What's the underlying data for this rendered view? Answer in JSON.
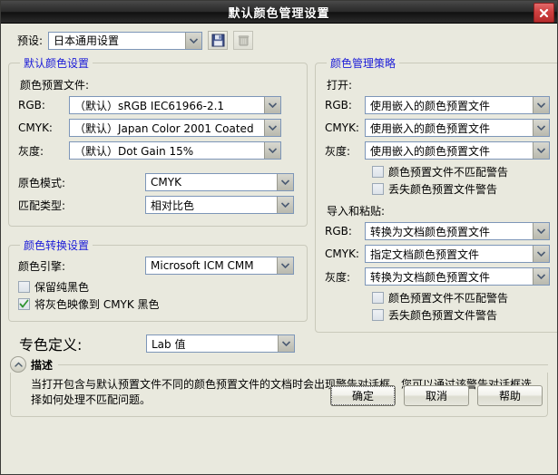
{
  "window": {
    "title": "默认颜色管理设置",
    "close_icon": "close-icon"
  },
  "preset": {
    "label": "预设:",
    "value": "日本通用设置",
    "save_icon": "save-disk-icon",
    "delete_icon": "trash-icon"
  },
  "default_color_settings": {
    "legend": "默认颜色设置",
    "profiles_label": "颜色预置文件:",
    "rows": [
      {
        "label": "RGB:",
        "value": "（默认）sRGB IEC61966-2.1"
      },
      {
        "label": "CMYK:",
        "value": "（默认）Japan Color 2001 Coated"
      },
      {
        "label": "灰度:",
        "value": "（默认）Dot Gain 15%"
      }
    ],
    "primary_mode": {
      "label": "原色模式:",
      "value": "CMYK"
    },
    "rendering_intent": {
      "label": "匹配类型:",
      "value": "相对比色"
    }
  },
  "color_conversion_settings": {
    "legend": "颜色转换设置",
    "engine": {
      "label": "颜色引擎:",
      "value": "Microsoft ICM CMM"
    },
    "checkboxes": [
      {
        "label": "保留纯黑色",
        "checked": false
      },
      {
        "label": "将灰色映像到 CMYK 黑色",
        "checked": true
      }
    ]
  },
  "spot_color": {
    "label": "专色定义:",
    "value": "Lab 值"
  },
  "color_management_policies": {
    "legend": "颜色管理策略",
    "open_label": "打开:",
    "open_rows": [
      {
        "label": "RGB:",
        "value": "使用嵌入的颜色预置文件"
      },
      {
        "label": "CMYK:",
        "value": "使用嵌入的颜色预置文件"
      },
      {
        "label": "灰度:",
        "value": "使用嵌入的颜色预置文件"
      }
    ],
    "open_checkboxes": [
      {
        "label": "颜色预置文件不匹配警告",
        "checked": false
      },
      {
        "label": "丢失颜色预置文件警告",
        "checked": false
      }
    ],
    "import_label": "导入和粘贴:",
    "import_rows": [
      {
        "label": "RGB:",
        "value": "转换为文档颜色预置文件"
      },
      {
        "label": "CMYK:",
        "value": "指定文档颜色预置文件"
      },
      {
        "label": "灰度:",
        "value": "转换为文档颜色预置文件"
      }
    ],
    "import_checkboxes": [
      {
        "label": "颜色预置文件不匹配警告",
        "checked": false
      },
      {
        "label": "丢失颜色预置文件警告",
        "checked": false
      }
    ]
  },
  "description": {
    "toggle_icon": "chevron-up-icon",
    "title": "描述",
    "text": "当打开包含与默认预置文件不同的颜色预置文件的文档时会出现警告对话框。您可以通过该警告对话框选择如何处理不匹配问题。"
  },
  "footer": {
    "ok": "确定",
    "cancel": "取消",
    "help": "帮助"
  },
  "colors": {
    "dialog_bg": "#e9e9de",
    "legend_blue": "#1b1bd8",
    "title_text": "#ffffff",
    "close_red": "#cf4040",
    "check_green": "#3a9a3a",
    "combo_border": "#7d96b8"
  }
}
